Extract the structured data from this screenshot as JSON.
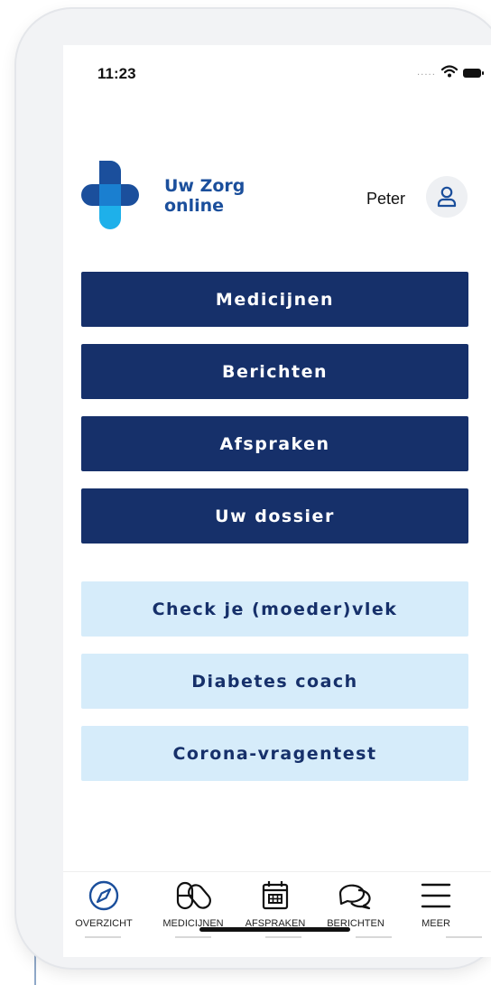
{
  "status_bar": {
    "time": "11:23",
    "signal": "....."
  },
  "brand": {
    "line1": "Uw Zorg",
    "line2": "online"
  },
  "user": {
    "name": "Peter"
  },
  "primary_buttons": [
    {
      "label": "Medicijnen"
    },
    {
      "label": "Berichten"
    },
    {
      "label": "Afspraken"
    },
    {
      "label": "Uw dossier"
    }
  ],
  "secondary_buttons": [
    {
      "label": "Check je (moeder)vlek"
    },
    {
      "label": "Diabetes coach"
    },
    {
      "label": "Corona-vragentest"
    }
  ],
  "tab_bar": [
    {
      "label": "OVERZICHT",
      "icon": "compass-icon"
    },
    {
      "label": "MEDICIJNEN",
      "icon": "pills-icon"
    },
    {
      "label": "AFSPRAKEN",
      "icon": "calendar-icon"
    },
    {
      "label": "BERICHTEN",
      "icon": "chat-bubbles-icon"
    },
    {
      "label": "MEER",
      "icon": "hamburger-menu-icon"
    }
  ],
  "colors": {
    "primary_dark": "#16306a",
    "secondary_light": "#d6ecfa",
    "brand_blue": "#1b4f9c",
    "brand_cyan": "#1eb0ea"
  }
}
